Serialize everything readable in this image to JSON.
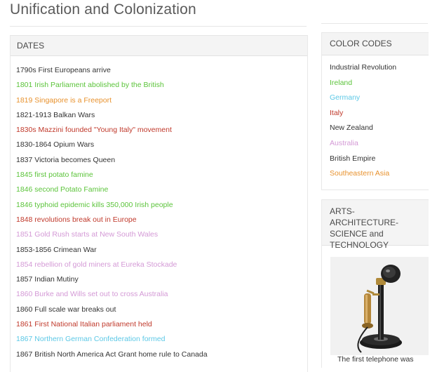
{
  "page": {
    "title": "Unification and Colonization"
  },
  "colors": {
    "industrial": "#333333",
    "ireland": "#5cc43b",
    "germany": "#5cc8e6",
    "italy": "#c0392b",
    "new_zealand": "#333333",
    "australia": "#d49ad6",
    "british_empire": "#333333",
    "southeastern_asia": "#e8922e"
  },
  "dates": {
    "header": "DATES",
    "items": [
      {
        "text": "1790s First Europeans arrive",
        "color": "#333333"
      },
      {
        "text": "1801 Irish Parliament abolished by the British",
        "color": "#5cc43b"
      },
      {
        "text": "1819 Singapore is a Freeport",
        "color": "#e8922e"
      },
      {
        "text": "1821-1913 Balkan Wars",
        "color": "#333333"
      },
      {
        "text": "1830s Mazzini founded \"Young Italy\" movement",
        "color": "#c0392b"
      },
      {
        "text": "1830-1864 Opium Wars",
        "color": "#333333"
      },
      {
        "text": "1837 Victoria becomes Queen",
        "color": "#333333"
      },
      {
        "text": "1845 first potato famine",
        "color": "#5cc43b"
      },
      {
        "text": "1846 second Potato Famine",
        "color": "#5cc43b"
      },
      {
        "text": "1846 typhoid epidemic kills 350,000 Irish people",
        "color": "#5cc43b"
      },
      {
        "text": "1848 revolutions break out in Europe",
        "color": "#c0392b"
      },
      {
        "text": "1851 Gold Rush starts at New South Wales",
        "color": "#d49ad6"
      },
      {
        "text": "1853-1856 Crimean War",
        "color": "#333333"
      },
      {
        "text": "1854 rebellion of gold miners at Eureka Stockade",
        "color": "#d49ad6"
      },
      {
        "text": "1857 Indian Mutiny",
        "color": "#333333"
      },
      {
        "text": "1860 Burke and Wills set out to cross Australia",
        "color": "#d49ad6"
      },
      {
        "text": "1860 Full scale war breaks out",
        "color": "#333333"
      },
      {
        "text": "1861 First National Italian parliament held",
        "color": "#c0392b"
      },
      {
        "text": "1867 Northern German Confederation formed",
        "color": "#5cc8e6"
      },
      {
        "text": "1867 British North America Act Grant home rule to Canada",
        "color": "#333333"
      }
    ]
  },
  "color_codes": {
    "header": "COLOR CODES",
    "items": [
      {
        "text": "Industrial Revolution",
        "color": "#333333"
      },
      {
        "text": "Ireland",
        "color": "#5cc43b"
      },
      {
        "text": "Germany",
        "color": "#5cc8e6"
      },
      {
        "text": "Italy",
        "color": "#c0392b"
      },
      {
        "text": "New Zealand",
        "color": "#333333"
      },
      {
        "text": "Australia",
        "color": "#d49ad6"
      },
      {
        "text": "British Empire",
        "color": "#333333"
      },
      {
        "text": "Southeastern Asia",
        "color": "#e8922e"
      }
    ]
  },
  "arts": {
    "header_line1": "ARTS-ARCHITECTURE-",
    "header_line2": "SCIENCE and",
    "header_line3": "TECHNOLOGY",
    "image_icon": "candlestick-telephone-image",
    "caption": "The first telephone was"
  }
}
